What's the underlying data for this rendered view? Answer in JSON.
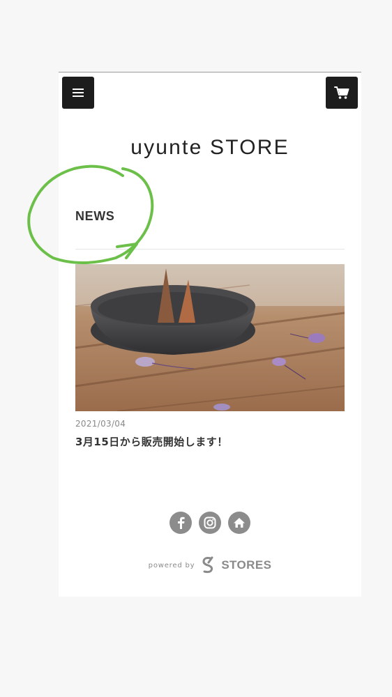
{
  "header": {
    "menu_icon": "hamburger-menu-icon",
    "cart_icon": "shopping-cart-icon",
    "store_title": "uyunte STORE"
  },
  "news": {
    "heading": "NEWS",
    "items": [
      {
        "date": "2021/03/04",
        "title": "3月15日から販売開始します！",
        "image": "photo of a dark ceramic incense dish with two cone incense on a wooden table with small purple petals"
      }
    ]
  },
  "footer": {
    "social_icons": [
      "facebook-icon",
      "instagram-icon",
      "home-icon"
    ],
    "powered_by": "powered by",
    "brand": "STORES"
  },
  "annotation": {
    "color": "#6cc04a",
    "shape": "hand-drawn circle around NEWS heading"
  },
  "colors": {
    "page_background": "#f7f7f7",
    "card_background": "#ffffff",
    "button_dark": "#1d1d1d",
    "icon_gray": "#8c8c8c"
  }
}
